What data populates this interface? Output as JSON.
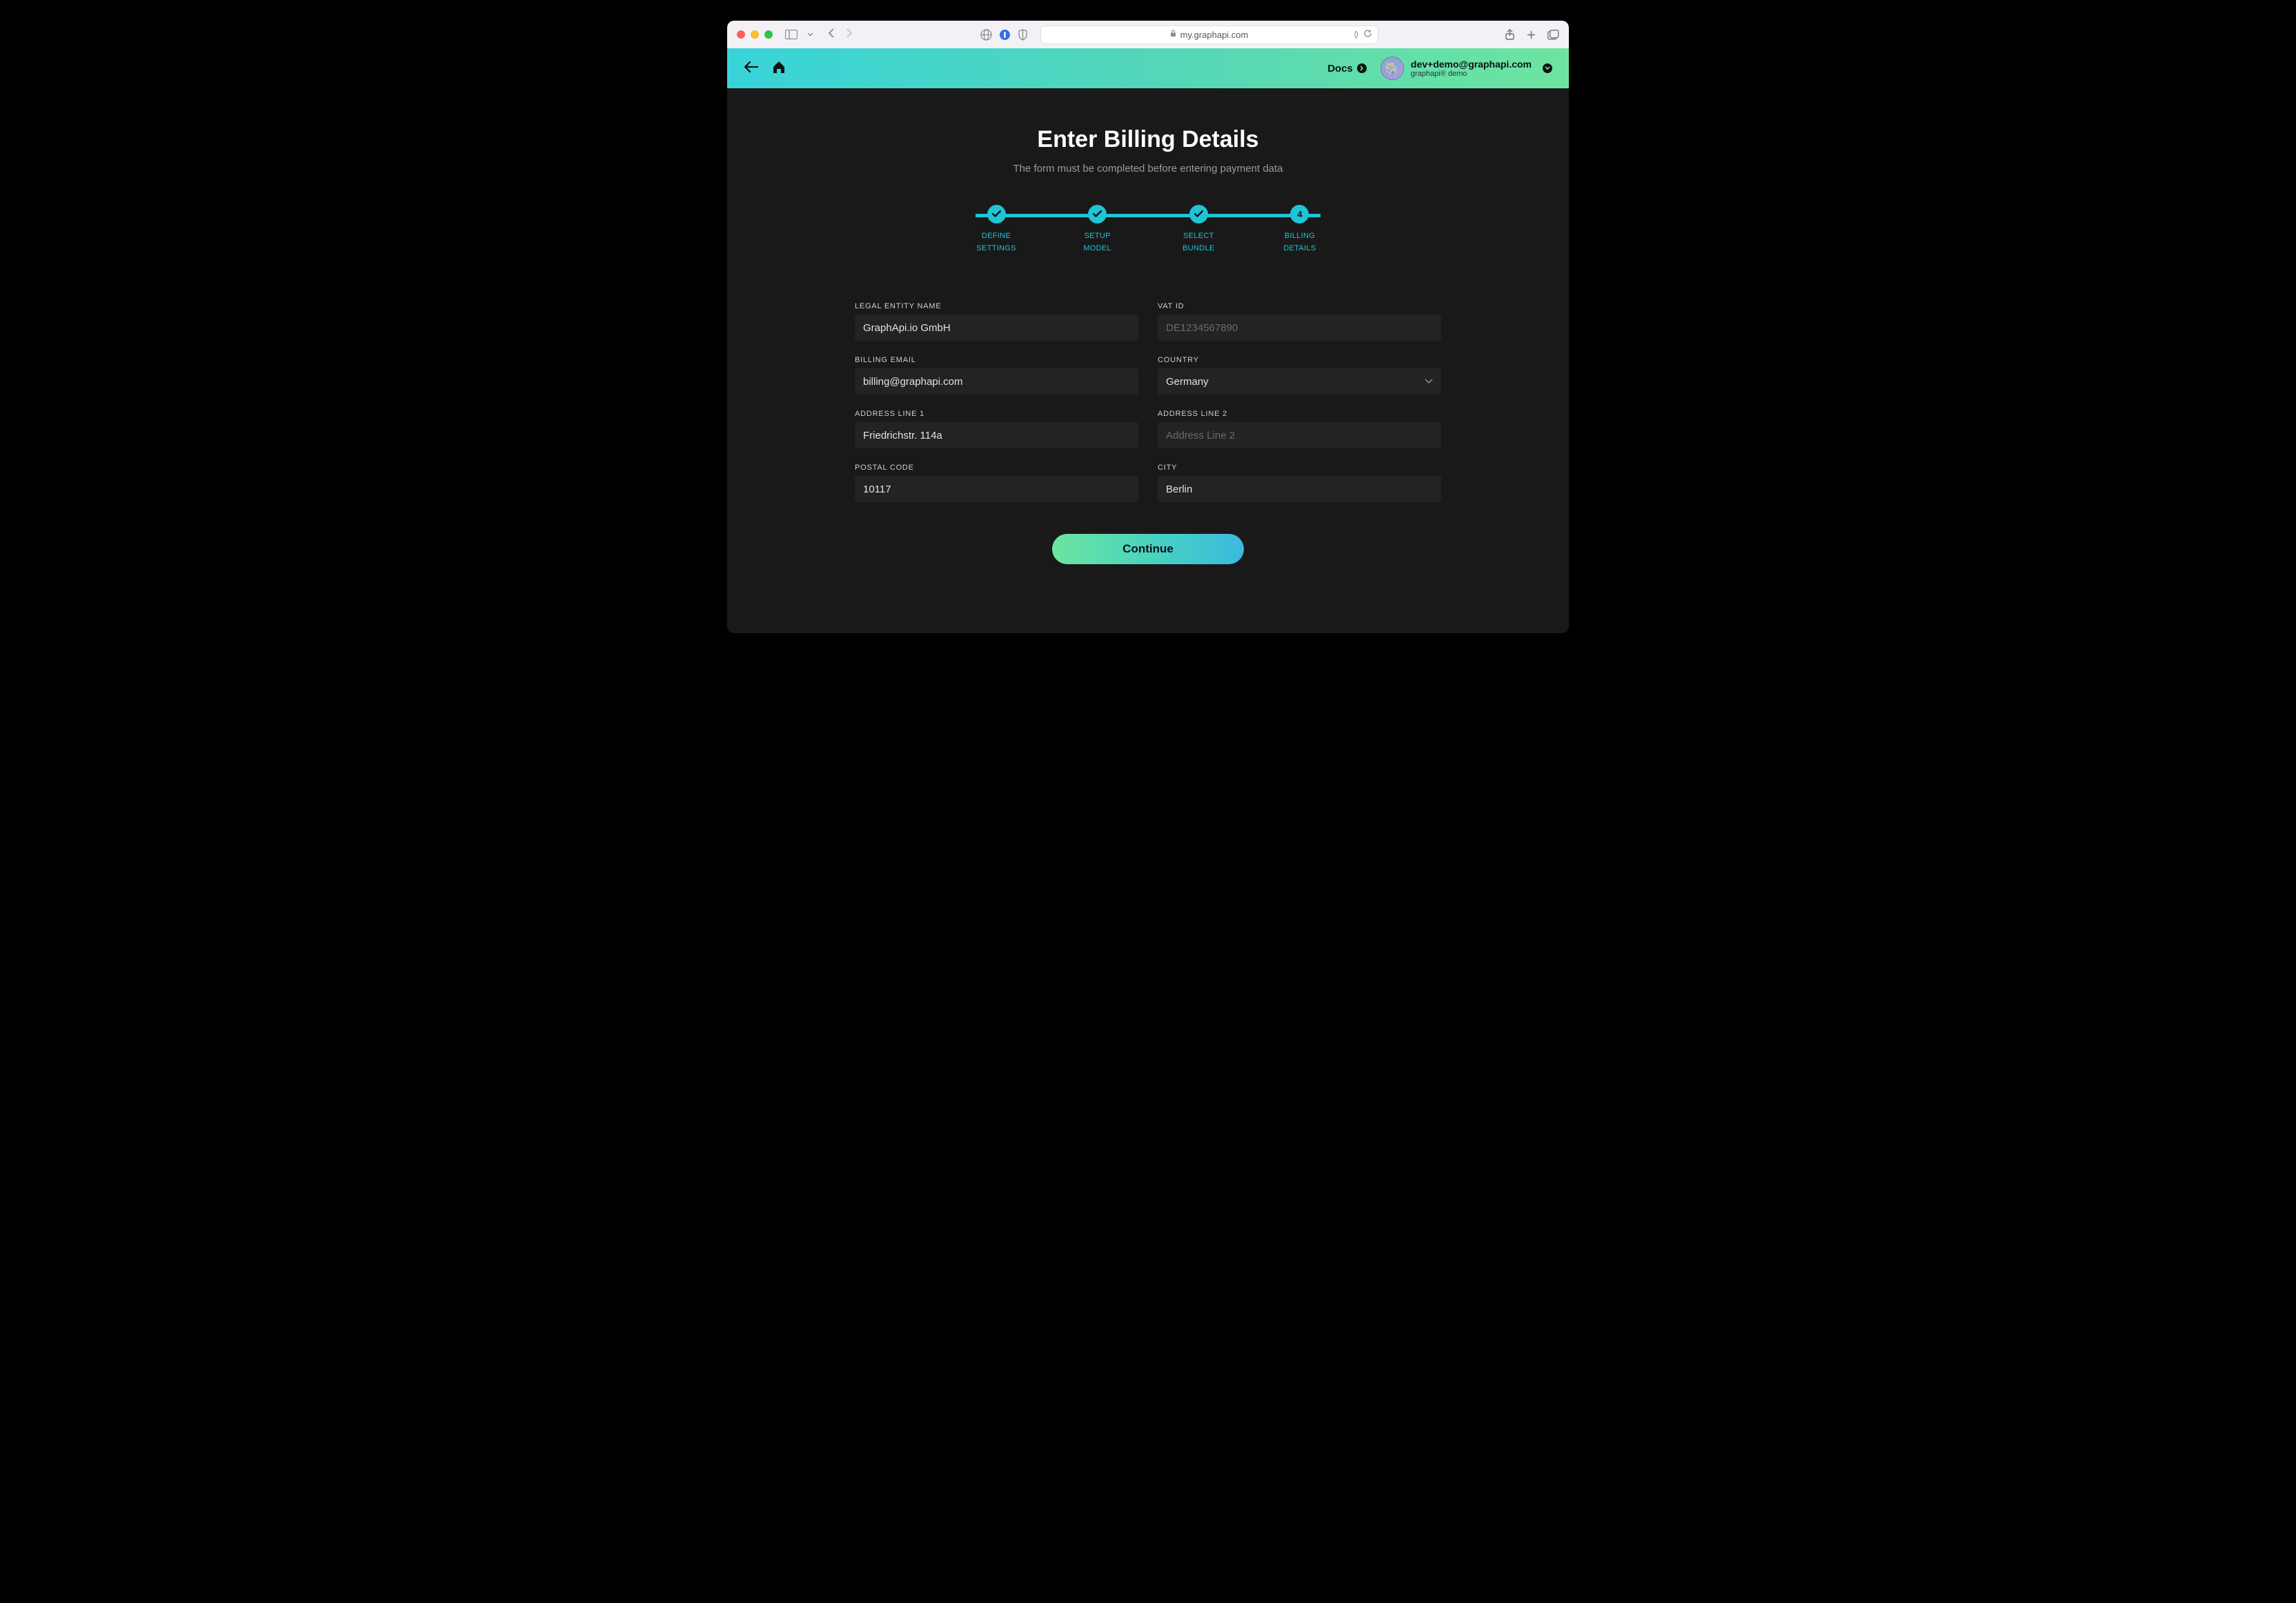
{
  "browser": {
    "url": "my.graphapi.com"
  },
  "header": {
    "docs_label": "Docs",
    "user_email": "dev+demo@graphapi.com",
    "user_org": "graphapi® demo"
  },
  "page": {
    "title": "Enter Billing Details",
    "subtitle": "The form must be completed before entering payment data"
  },
  "stepper": {
    "steps": [
      {
        "label": "DEFINE\nSETTINGS",
        "state": "done"
      },
      {
        "label": "SETUP\nMODEL",
        "state": "done"
      },
      {
        "label": "SELECT\nBUNDLE",
        "state": "done"
      },
      {
        "label": "BILLING\nDETAILS",
        "state": "current",
        "number": "4"
      }
    ]
  },
  "form": {
    "legal_entity": {
      "label": "LEGAL ENTITY NAME",
      "value": "GraphApi.io GmbH"
    },
    "vat_id": {
      "label": "VAT ID",
      "placeholder": "DE1234567890"
    },
    "billing_email": {
      "label": "BILLING EMAIL",
      "value": "billing@graphapi.com"
    },
    "country": {
      "label": "COUNTRY",
      "value": "Germany"
    },
    "address1": {
      "label": "ADDRESS LINE 1",
      "value": "Friedrichstr. 114a"
    },
    "address2": {
      "label": "ADDRESS LINE 2",
      "placeholder": "Address Line 2"
    },
    "postal": {
      "label": "POSTAL CODE",
      "value": "10117"
    },
    "city": {
      "label": "CITY",
      "value": "Berlin"
    }
  },
  "actions": {
    "continue": "Continue"
  }
}
